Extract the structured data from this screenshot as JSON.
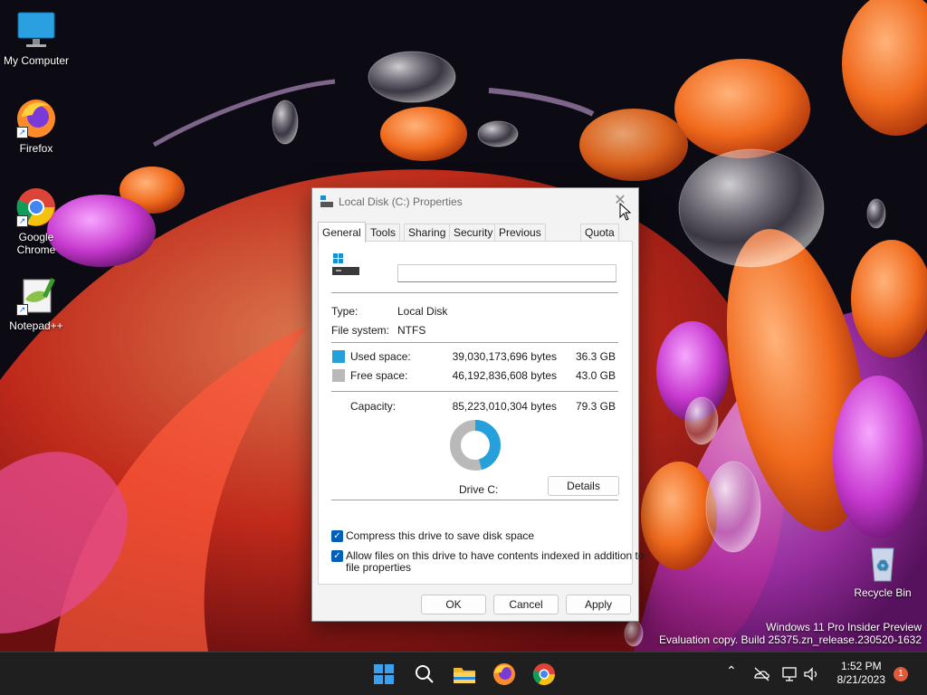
{
  "desktop": {
    "icons": [
      {
        "label": "My Computer"
      },
      {
        "label": "Firefox"
      },
      {
        "label": "Google Chrome"
      },
      {
        "label": "Notepad++"
      },
      {
        "label": "Recycle Bin"
      }
    ],
    "watermark": {
      "line1": "Windows 11 Pro Insider Preview",
      "line2": "Evaluation copy. Build 25375.zn_release.230520-1632"
    }
  },
  "dialog": {
    "title": "Local Disk (C:) Properties",
    "close_icon": "close-icon",
    "tabs": [
      "General",
      "Tools",
      "Sharing",
      "Security",
      "Previous Versions",
      "Quota"
    ],
    "active_tab": "General",
    "drive_name_value": "",
    "type_label": "Type:",
    "type_value": "Local Disk",
    "fs_label": "File system:",
    "fs_value": "NTFS",
    "used_label": "Used space:",
    "used_bytes": "39,030,173,696 bytes",
    "used_gb": "36.3 GB",
    "free_label": "Free space:",
    "free_bytes": "46,192,836,608 bytes",
    "free_gb": "43.0 GB",
    "capacity_label": "Capacity:",
    "capacity_bytes": "85,223,010,304 bytes",
    "capacity_gb": "79.3 GB",
    "used_fraction": 0.458,
    "drive_label": "Drive C:",
    "details_label": "Details",
    "compress_label": "Compress this drive to save disk space",
    "compress_checked": true,
    "index_label_line1": "Allow files on this drive to have contents indexed in addition to",
    "index_label_line2": "file properties",
    "index_checked": true,
    "ok_label": "OK",
    "cancel_label": "Cancel",
    "apply_label": "Apply",
    "colors": {
      "used": "#26a0da",
      "free": "#b9b9b9"
    }
  },
  "taskbar": {
    "items": [
      "start-icon",
      "search-icon",
      "file-explorer-icon",
      "firefox-icon",
      "chrome-icon"
    ],
    "tray_icons": [
      "chevron-up-icon",
      "onedrive-offline-icon",
      "network-icon",
      "volume-icon"
    ],
    "time": "1:52 PM",
    "date": "8/21/2023",
    "notification_count": "1"
  }
}
